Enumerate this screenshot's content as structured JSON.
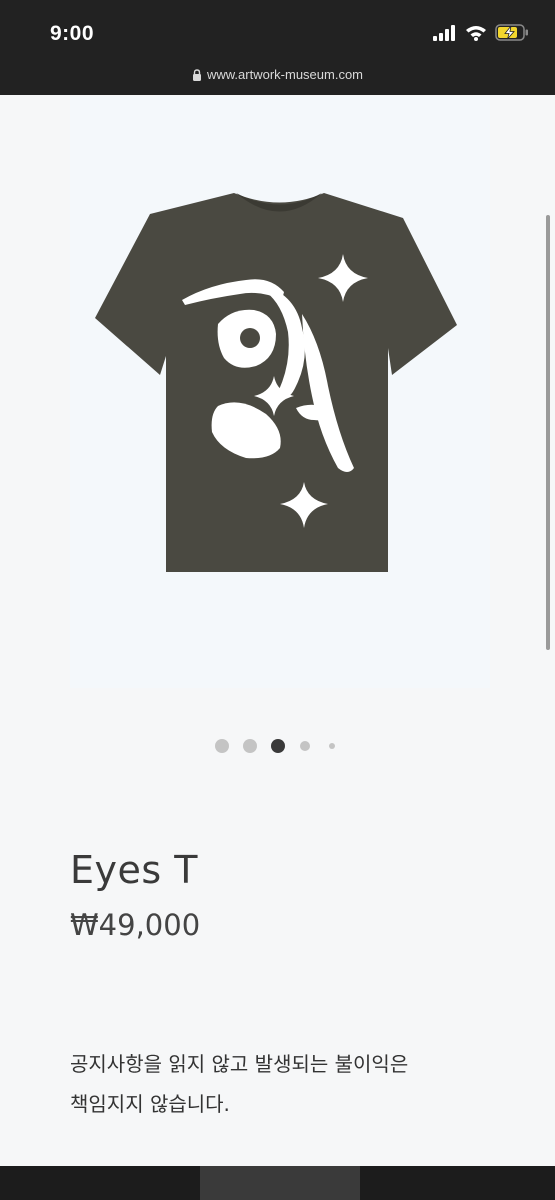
{
  "status_bar": {
    "time": "9:00",
    "icons": [
      "signal-icon",
      "wifi-icon",
      "battery-charging-icon"
    ]
  },
  "browser": {
    "url": "www.artwork-museum.com",
    "icons": [
      "lock-icon"
    ]
  },
  "gallery": {
    "image": "t-shirt-photo",
    "shirt_color": "#4a4941",
    "print_color": "#ffffff",
    "page_indicator": {
      "total": 5,
      "active": 3
    }
  },
  "product": {
    "title": "Eyes T",
    "price": "₩49,000"
  },
  "notice": {
    "line1": "공지사항을 읽지 않고 발생되는 불이익은",
    "line2": "책임지지 않습니다."
  },
  "colors": {
    "top_bar": "#222222",
    "page_bg": "#f6f7f8",
    "dot_active": "#3a3a3a",
    "dot_inactive": "#c4c4c4"
  }
}
